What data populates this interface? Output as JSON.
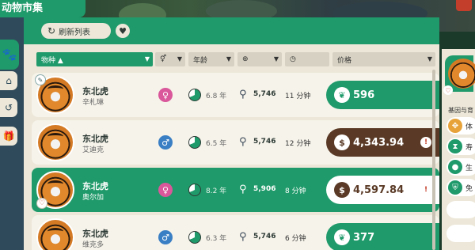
{
  "window": {
    "title": "动物市集"
  },
  "toolbar": {
    "refresh_label": "刷新列表"
  },
  "headers": {
    "species": "物种 ▲",
    "age": "年龄",
    "price": "价格"
  },
  "rows": [
    {
      "name": "东北虎",
      "sub": "辛札琳",
      "gender": "♀",
      "age": "6.8 年",
      "licence": "5,746",
      "time": "11 分钟",
      "price": "596",
      "price_style": "green",
      "warning": false
    },
    {
      "name": "东北虎",
      "sub": "艾迪克",
      "gender": "♂",
      "age": "6.5 年",
      "licence": "5,746",
      "time": "12 分钟",
      "price": "4,343.94",
      "price_style": "brown",
      "warning": true
    },
    {
      "name": "东北虎",
      "sub": "奥尔加",
      "gender": "♀",
      "age": "8.2 年",
      "licence": "5,906",
      "time": "8 分钟",
      "price": "4,597.84",
      "price_style": "white",
      "warning": true
    },
    {
      "name": "东北虎",
      "sub": "维克多",
      "gender": "♂",
      "age": "6.3 年",
      "licence": "5,746",
      "time": "6 分钟",
      "price": "377",
      "price_style": "green",
      "warning": false
    }
  ],
  "right_panel": {
    "section_label": "基因与育",
    "traits": [
      "体",
      "寿",
      "生",
      "免"
    ]
  },
  "colors": {
    "accent": "#1f9a6a",
    "brown": "#5a3a26",
    "female": "#d9579a",
    "male": "#3a7fc4",
    "warning": "#c43f2b"
  }
}
